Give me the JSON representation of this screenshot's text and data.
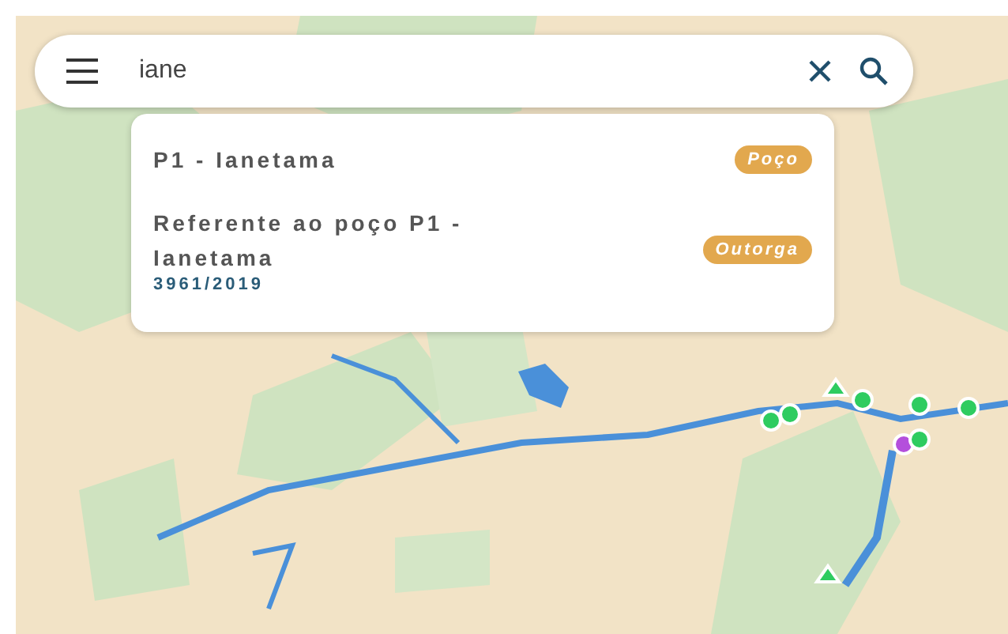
{
  "search": {
    "value": "iane"
  },
  "results": [
    {
      "title": "P1 - Ianetama",
      "tag": "Poço"
    },
    {
      "title": "Referente ao poço P1 - Ianetama",
      "subtitle": "3961/2019",
      "tag": "Outorga"
    }
  ]
}
